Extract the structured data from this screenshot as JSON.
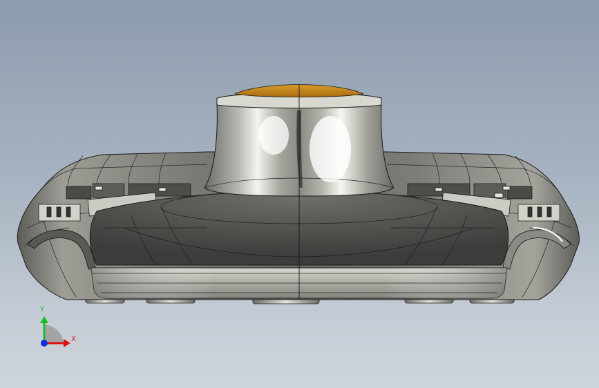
{
  "viewport": {
    "background_top": "#8d9cae",
    "background_bottom": "#cfd5dc"
  },
  "model": {
    "body_color": "#8f8f88",
    "dome_color": "#c98a1a",
    "edge_color": "#1a1a1a"
  },
  "triad": {
    "x_label": "X",
    "y_label": "Y",
    "x_color": "#e01010",
    "y_color": "#10c020",
    "z_color": "#1030e0"
  }
}
